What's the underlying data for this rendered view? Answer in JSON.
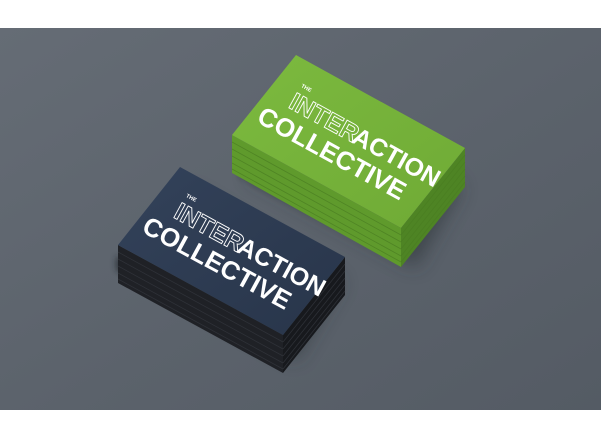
{
  "green_card": {
    "small": "THE",
    "outline": "INTER",
    "bold": "ACTION",
    "bottom": "COLLECTIVE"
  },
  "navy_card": {
    "small": "THE",
    "outline": "INTER",
    "bold": "ACTION",
    "bottom": "COLLECTIVE"
  },
  "colors": {
    "backdrop": "#5b626b",
    "green_card": "#78b53c",
    "navy_card": "#2d3b4c",
    "card_text": "#ffffff"
  }
}
